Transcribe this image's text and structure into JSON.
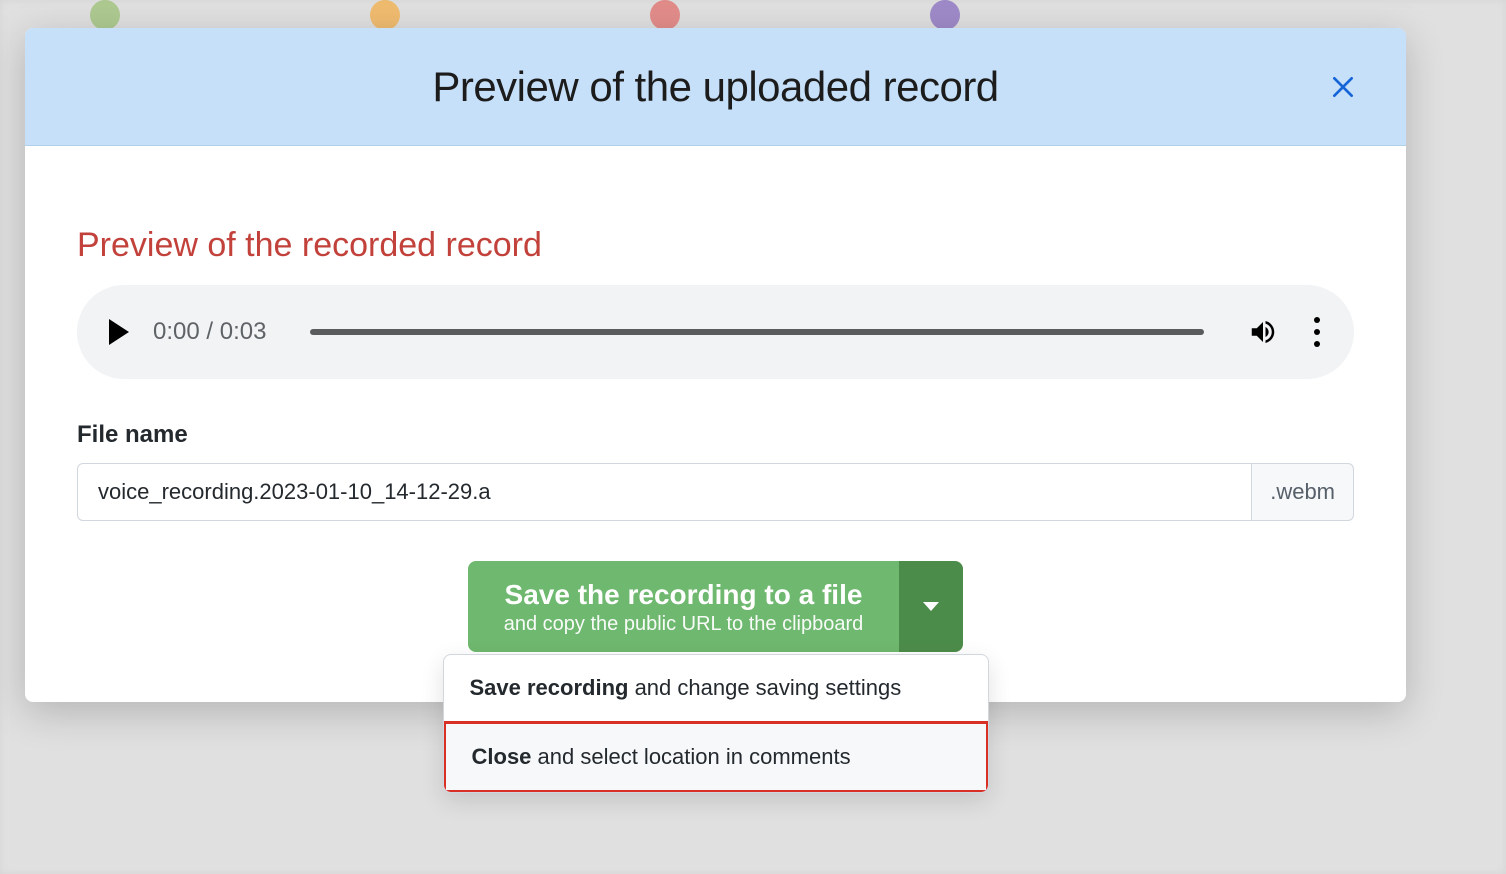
{
  "modal": {
    "header_title": "Preview of the uploaded record"
  },
  "preview": {
    "title": "Preview of the recorded record"
  },
  "audio": {
    "current_time": "0:00",
    "duration": "0:03",
    "time_display": "0:00 / 0:03"
  },
  "file": {
    "label": "File name",
    "name_value": "voice_recording.2023-01-10_14-12-29.a",
    "extension": ".webm"
  },
  "actions": {
    "save_main": "Save the recording to a file",
    "save_sub": "and copy the public URL to the clipboard"
  },
  "dropdown": {
    "item1_bold": "Save recording",
    "item1_rest": " and change saving settings",
    "item2_bold": "Close",
    "item2_rest": " and select location in comments"
  }
}
